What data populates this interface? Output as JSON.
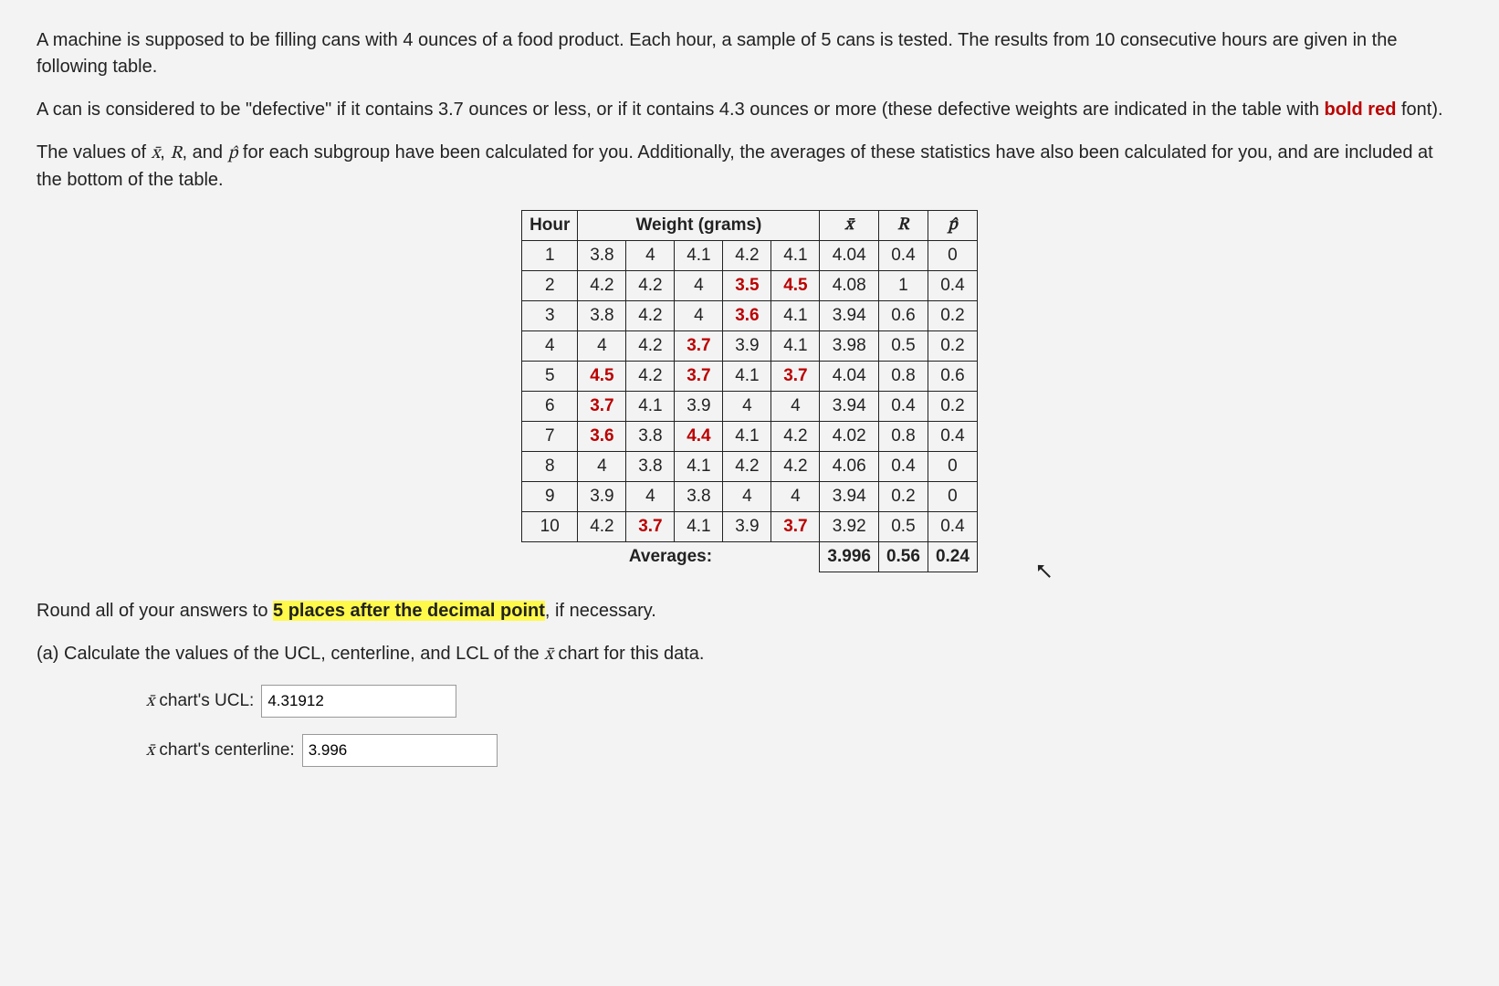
{
  "intro": {
    "p1_a": "A machine is supposed to be filling cans with 4 ounces of a food product. Each hour, a sample of 5 cans is tested. The results from 10 consecutive hours are given in the following table.",
    "p2_a": "A can is considered to be \"defective\" if it contains 3.7 ounces or less, or if it contains 4.3 ounces or more (these defective weights are indicated in the table with ",
    "p2_bold": "bold red",
    "p2_b": " font).",
    "p3_a": "The values of ",
    "p3_b": ", and ",
    "p3_c": " for each subgroup have been calculated for you.  Additionally, the averages of these statistics have also been calculated for you, and are included at the bottom of the table."
  },
  "symbols": {
    "xbar": "x̄",
    "R": "R",
    "phat": "p̂"
  },
  "table": {
    "headers": {
      "hour": "Hour",
      "weight": "Weight (grams)",
      "xbar": "x̄",
      "R": "R",
      "phat": "p̂"
    },
    "rows": [
      {
        "hour": "1",
        "w": [
          {
            "v": "3.8"
          },
          {
            "v": "4"
          },
          {
            "v": "4.1"
          },
          {
            "v": "4.2"
          },
          {
            "v": "4.1"
          }
        ],
        "xbar": "4.04",
        "R": "0.4",
        "p": "0"
      },
      {
        "hour": "2",
        "w": [
          {
            "v": "4.2"
          },
          {
            "v": "4.2"
          },
          {
            "v": "4"
          },
          {
            "v": "3.5",
            "d": true
          },
          {
            "v": "4.5",
            "d": true
          }
        ],
        "xbar": "4.08",
        "R": "1",
        "p": "0.4"
      },
      {
        "hour": "3",
        "w": [
          {
            "v": "3.8"
          },
          {
            "v": "4.2"
          },
          {
            "v": "4"
          },
          {
            "v": "3.6",
            "d": true
          },
          {
            "v": "4.1"
          }
        ],
        "xbar": "3.94",
        "R": "0.6",
        "p": "0.2"
      },
      {
        "hour": "4",
        "w": [
          {
            "v": "4"
          },
          {
            "v": "4.2"
          },
          {
            "v": "3.7",
            "d": true
          },
          {
            "v": "3.9"
          },
          {
            "v": "4.1"
          }
        ],
        "xbar": "3.98",
        "R": "0.5",
        "p": "0.2"
      },
      {
        "hour": "5",
        "w": [
          {
            "v": "4.5",
            "d": true
          },
          {
            "v": "4.2"
          },
          {
            "v": "3.7",
            "d": true
          },
          {
            "v": "4.1"
          },
          {
            "v": "3.7",
            "d": true
          }
        ],
        "xbar": "4.04",
        "R": "0.8",
        "p": "0.6"
      },
      {
        "hour": "6",
        "w": [
          {
            "v": "3.7",
            "d": true
          },
          {
            "v": "4.1"
          },
          {
            "v": "3.9"
          },
          {
            "v": "4"
          },
          {
            "v": "4"
          }
        ],
        "xbar": "3.94",
        "R": "0.4",
        "p": "0.2"
      },
      {
        "hour": "7",
        "w": [
          {
            "v": "3.6",
            "d": true
          },
          {
            "v": "3.8"
          },
          {
            "v": "4.4",
            "d": true
          },
          {
            "v": "4.1"
          },
          {
            "v": "4.2"
          }
        ],
        "xbar": "4.02",
        "R": "0.8",
        "p": "0.4"
      },
      {
        "hour": "8",
        "w": [
          {
            "v": "4"
          },
          {
            "v": "3.8"
          },
          {
            "v": "4.1"
          },
          {
            "v": "4.2"
          },
          {
            "v": "4.2"
          }
        ],
        "xbar": "4.06",
        "R": "0.4",
        "p": "0"
      },
      {
        "hour": "9",
        "w": [
          {
            "v": "3.9"
          },
          {
            "v": "4"
          },
          {
            "v": "3.8"
          },
          {
            "v": "4"
          },
          {
            "v": "4"
          }
        ],
        "xbar": "3.94",
        "R": "0.2",
        "p": "0"
      },
      {
        "hour": "10",
        "w": [
          {
            "v": "4.2"
          },
          {
            "v": "3.7",
            "d": true
          },
          {
            "v": "4.1"
          },
          {
            "v": "3.9"
          },
          {
            "v": "3.7",
            "d": true
          }
        ],
        "xbar": "3.92",
        "R": "0.5",
        "p": "0.4"
      }
    ],
    "averages": {
      "label": "Averages:",
      "xbar": "3.996",
      "R": "0.56",
      "p": "0.24"
    }
  },
  "instructions": {
    "round_a": "Round all of your answers to ",
    "round_hl": "5 places after the decimal point",
    "round_b": ", if necessary.",
    "part_a": "(a) Calculate the values of the UCL, centerline, and LCL of the ",
    "part_a_sym": "x̄",
    "part_a_b": "  chart for this data."
  },
  "fields": {
    "ucl_label_a": "x̄",
    "ucl_label_b": " chart's UCL:",
    "ucl_value": "4.31912",
    "cl_label_a": "x̄",
    "cl_label_b": " chart's centerline:",
    "cl_value": "3.996"
  }
}
